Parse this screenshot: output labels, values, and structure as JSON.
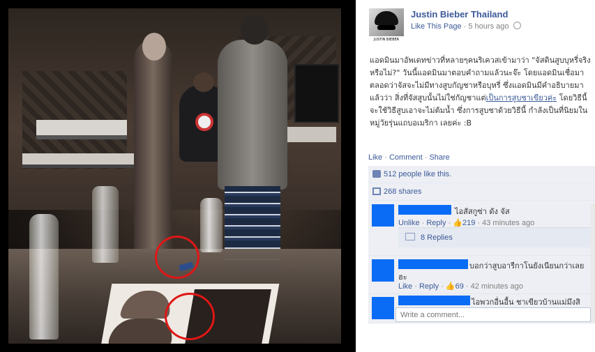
{
  "post": {
    "page_name": "Justin Bieber Thailand",
    "like_page": "Like This Page",
    "time": "5 hours ago",
    "body_before": "แอดมินมาอัพเดทข่าวที่หลายๆคนริเควสเข้ามาว่า \"จัสดินสูบบุหรี่จริงหรือไม่?\" วันนี้แอดมินมาตอบคำถามแล้วนะจ๊ะ โดยแอดมินเชื่อมาตลอดว่าจัสจะไม่มีทางสูบกัญชาหรือบุหรี่ ซึ่งแอดมินมีคำอธิบายมาแล้วว่า สิ่งที่จัสสูบนั้นไม่ใช่กัญชาแต่",
    "body_highlight": "เป็นการสูบชาเขียวค่ะ",
    "body_after": " โดยวิธีนี้จะใช้วิธีสูบเอาจะไม่ต้มน้ำ ซึ่งการสูบชาด้วยวิธีนี้ กำลังเป็นที่นิยมในหมู่วัยรุ่นแถบอเมริกา เลยค่ะ :B",
    "actions": {
      "like": "Like",
      "comment": "Comment",
      "share": "Share",
      "sep": " · "
    }
  },
  "avatar_band_text": "JUSTIN BIEBER",
  "ufi": {
    "likes": "512 people like this.",
    "shares": "268 shares"
  },
  "comments": [
    {
      "text": "ไอสัสกูซ่า ดัง จัส",
      "unlike": "Unlike",
      "reply": "Reply",
      "likes": "219",
      "time": "43 minutes ago",
      "replies": "8 Replies"
    },
    {
      "text_line1": "บอกว่าสูบอารีกาโนยังเนียนกว่าเลย",
      "text_line2": "ฮะ",
      "like": "Like",
      "reply": "Reply",
      "likes": "69",
      "time": "42 minutes ago"
    },
    {
      "text": "ไอพวกอื่นอื้น ชาเขียวบ้านแม่มึงสิ"
    }
  ],
  "composer": {
    "placeholder": "Write a comment..."
  },
  "colors": {
    "fb_blue": "#3b5998",
    "redact_blue": "#0a6cf5",
    "circle_red": "#e01616"
  }
}
